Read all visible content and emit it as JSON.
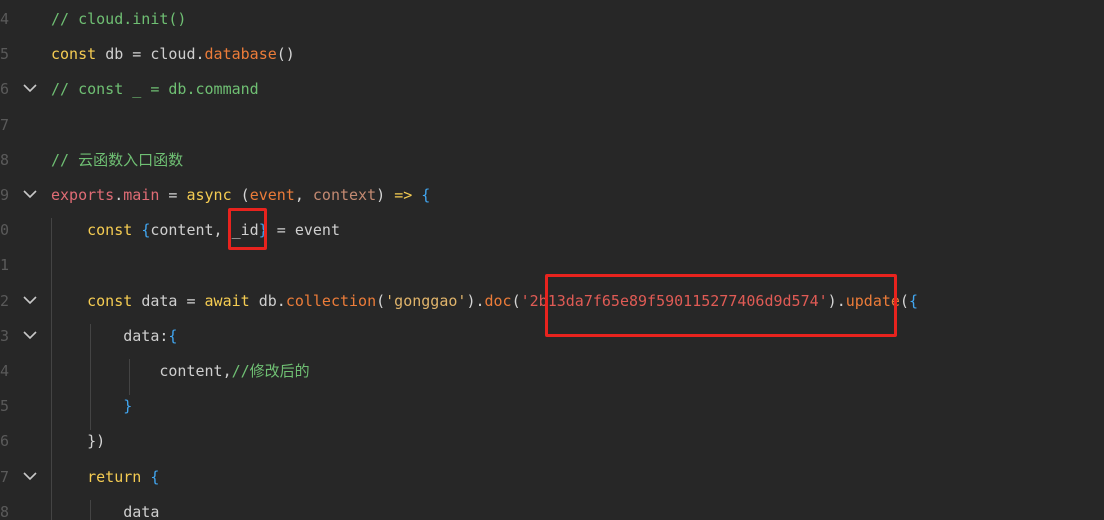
{
  "editor": {
    "lines": [
      {
        "num": "4",
        "fold": false,
        "tokens": [
          {
            "t": "// cloud.init()",
            "c": "c-comment"
          }
        ]
      },
      {
        "num": "5",
        "fold": false,
        "tokens": [
          {
            "t": "const ",
            "c": "c-kw"
          },
          {
            "t": "db",
            "c": "c-var"
          },
          {
            "t": " = ",
            "c": "c-punc"
          },
          {
            "t": "cloud",
            "c": "c-var"
          },
          {
            "t": ".",
            "c": "c-punc"
          },
          {
            "t": "database",
            "c": "c-fn"
          },
          {
            "t": "()",
            "c": "c-punc"
          }
        ]
      },
      {
        "num": "6",
        "fold": true,
        "tokens": [
          {
            "t": "// const _ = db.command",
            "c": "c-comment"
          }
        ]
      },
      {
        "num": "7",
        "fold": false,
        "tokens": []
      },
      {
        "num": "8",
        "fold": false,
        "tokens": [
          {
            "t": "// 云函数入口函数",
            "c": "c-comment"
          }
        ]
      },
      {
        "num": "9",
        "fold": true,
        "tokens": [
          {
            "t": "exports",
            "c": "c-prop"
          },
          {
            "t": ".",
            "c": "c-punc"
          },
          {
            "t": "main",
            "c": "c-prop"
          },
          {
            "t": " = ",
            "c": "c-punc"
          },
          {
            "t": "async",
            "c": "c-kw"
          },
          {
            "t": " (",
            "c": "c-punc"
          },
          {
            "t": "event",
            "c": "c-fn"
          },
          {
            "t": ", ",
            "c": "c-punc"
          },
          {
            "t": "context",
            "c": "c-param"
          },
          {
            "t": ") ",
            "c": "c-punc"
          },
          {
            "t": "=>",
            "c": "c-kw"
          },
          {
            "t": " {",
            "c": "c-brace"
          }
        ]
      },
      {
        "num": "0",
        "fold": false,
        "tokens": [
          {
            "t": "    const ",
            "c": "c-kw"
          },
          {
            "t": "{",
            "c": "c-brace"
          },
          {
            "t": "content, _id",
            "c": "c-var"
          },
          {
            "t": "}",
            "c": "c-brace"
          },
          {
            "t": " = event",
            "c": "c-var"
          }
        ]
      },
      {
        "num": "1",
        "fold": false,
        "tokens": []
      },
      {
        "num": "2",
        "fold": true,
        "tokens": [
          {
            "t": "    const ",
            "c": "c-kw"
          },
          {
            "t": "data",
            "c": "c-var"
          },
          {
            "t": " = ",
            "c": "c-punc"
          },
          {
            "t": "await ",
            "c": "c-kw"
          },
          {
            "t": "db",
            "c": "c-var"
          },
          {
            "t": ".",
            "c": "c-punc"
          },
          {
            "t": "collection",
            "c": "c-fn"
          },
          {
            "t": "(",
            "c": "c-punc"
          },
          {
            "t": "'gonggao'",
            "c": "c-str"
          },
          {
            "t": ").",
            "c": "c-punc"
          },
          {
            "t": "doc",
            "c": "c-fn"
          },
          {
            "t": "(",
            "c": "c-punc"
          },
          {
            "t": "'2b13da7f65e89f590115277406d9d574'",
            "c": "c-strval"
          },
          {
            "t": ").",
            "c": "c-punc"
          },
          {
            "t": "update",
            "c": "c-fn"
          },
          {
            "t": "(",
            "c": "c-punc"
          },
          {
            "t": "{",
            "c": "c-brace"
          }
        ]
      },
      {
        "num": "3",
        "fold": true,
        "tokens": [
          {
            "t": "        data:",
            "c": "c-var"
          },
          {
            "t": "{",
            "c": "c-brace"
          }
        ]
      },
      {
        "num": "4",
        "fold": false,
        "tokens": [
          {
            "t": "            content,",
            "c": "c-var"
          },
          {
            "t": "//修改后的",
            "c": "c-comment"
          }
        ]
      },
      {
        "num": "5",
        "fold": false,
        "tokens": [
          {
            "t": "        }",
            "c": "c-brace"
          }
        ]
      },
      {
        "num": "6",
        "fold": false,
        "tokens": [
          {
            "t": "    })",
            "c": "c-punc"
          }
        ]
      },
      {
        "num": "7",
        "fold": true,
        "tokens": [
          {
            "t": "    return ",
            "c": "c-kw"
          },
          {
            "t": "{",
            "c": "c-brace"
          }
        ]
      },
      {
        "num": "8",
        "fold": false,
        "tokens": [
          {
            "t": "        data",
            "c": "c-var"
          }
        ]
      }
    ]
  },
  "highlight_color": "#e8231e"
}
